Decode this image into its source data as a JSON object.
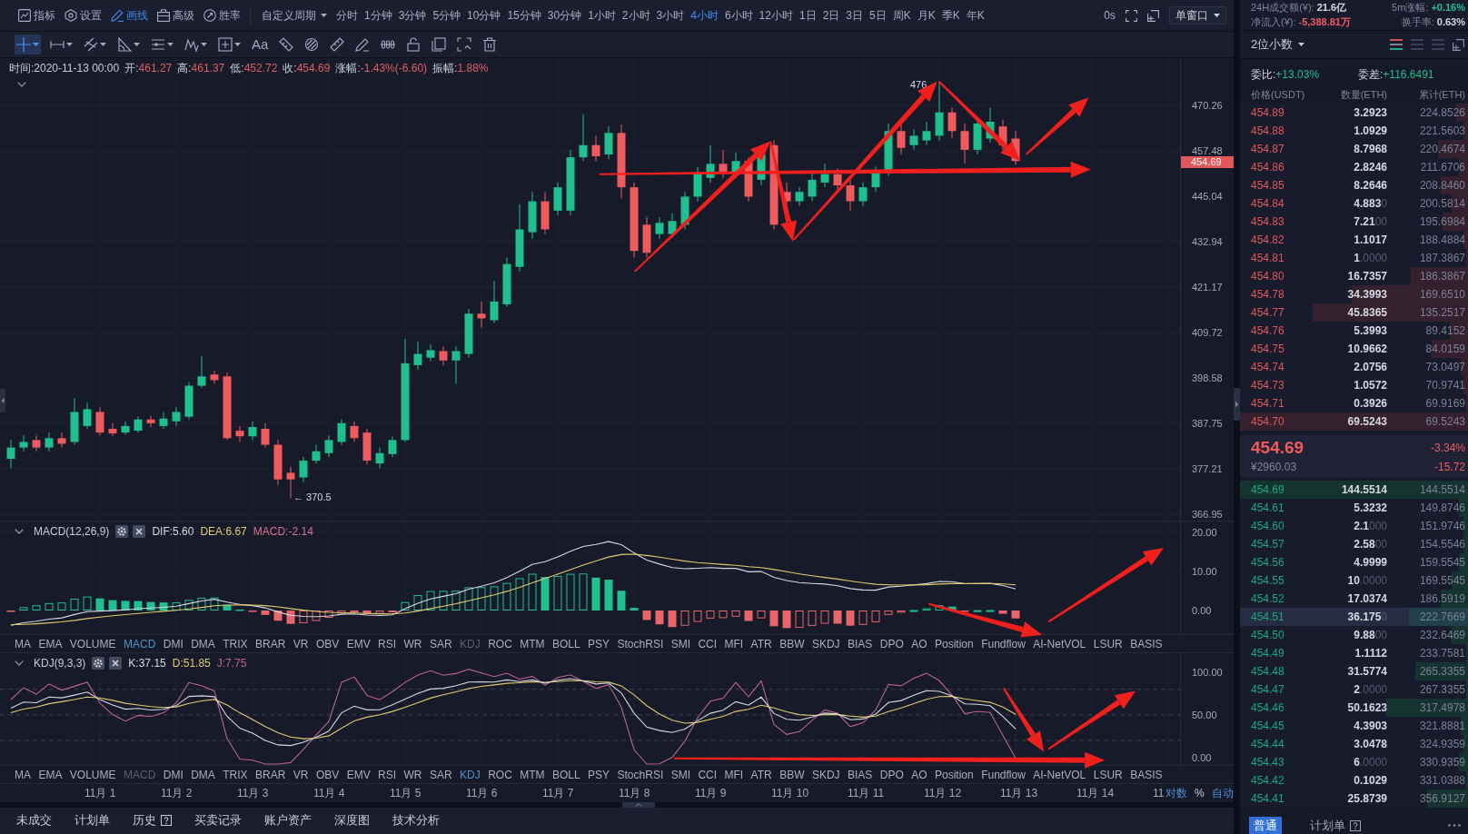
{
  "top_toolbar": {
    "tools": [
      {
        "label": "指标",
        "selected": false
      },
      {
        "label": "设置",
        "selected": false
      },
      {
        "label": "画线",
        "selected": true
      },
      {
        "label": "高级",
        "selected": false
      },
      {
        "label": "胜率",
        "selected": false
      }
    ],
    "period_menu": "自定义周期",
    "periods": [
      {
        "label": "分时",
        "selected": false
      },
      {
        "label": "1分钟",
        "selected": false
      },
      {
        "label": "3分钟",
        "selected": false
      },
      {
        "label": "5分钟",
        "selected": false
      },
      {
        "label": "10分钟",
        "selected": false
      },
      {
        "label": "15分钟",
        "selected": false
      },
      {
        "label": "30分钟",
        "selected": false
      },
      {
        "label": "1小时",
        "selected": false
      },
      {
        "label": "2小时",
        "selected": false
      },
      {
        "label": "3小时",
        "selected": false
      },
      {
        "label": "4小时",
        "selected": true
      },
      {
        "label": "6小时",
        "selected": false
      },
      {
        "label": "12小时",
        "selected": false
      },
      {
        "label": "1日",
        "selected": false
      },
      {
        "label": "2日",
        "selected": false
      },
      {
        "label": "3日",
        "selected": false
      },
      {
        "label": "5日",
        "selected": false
      },
      {
        "label": "周K",
        "selected": false
      },
      {
        "label": "月K",
        "selected": false
      },
      {
        "label": "季K",
        "selected": false
      },
      {
        "label": "年K",
        "selected": false
      }
    ],
    "timer": "0s",
    "layout_menu": "单窗口"
  },
  "drawing_toolbar": {
    "tools": [
      {
        "kind": "icon",
        "selected": true,
        "menu": true
      },
      {
        "kind": "icon",
        "selected": false,
        "menu": true
      },
      {
        "kind": "icon",
        "selected": false,
        "menu": true
      },
      {
        "kind": "icon",
        "selected": false,
        "menu": true
      },
      {
        "kind": "icon",
        "selected": false,
        "menu": true
      },
      {
        "kind": "icon",
        "selected": false,
        "menu": true
      },
      {
        "kind": "icon",
        "selected": false,
        "menu": true
      },
      {
        "kind": "text",
        "label": "Aa",
        "selected": false,
        "menu": false
      },
      {
        "kind": "icon",
        "selected": false,
        "menu": false
      },
      {
        "kind": "icon",
        "selected": false,
        "menu": false
      },
      {
        "kind": "icon",
        "selected": false,
        "menu": false
      },
      {
        "kind": "icon",
        "selected": false,
        "menu": false
      },
      {
        "kind": "icon",
        "selected": false,
        "menu": false
      },
      {
        "kind": "icon",
        "selected": false,
        "menu": false
      },
      {
        "kind": "icon",
        "selected": false,
        "menu": false
      },
      {
        "kind": "icon",
        "selected": false,
        "menu": false
      },
      {
        "kind": "icon",
        "selected": false,
        "menu": false
      }
    ]
  },
  "quote_bar": {
    "time": "时间:2020-11-13 00:00",
    "fields": [
      {
        "label": "开:",
        "value": "461.27"
      },
      {
        "label": "高:",
        "value": "461.37"
      },
      {
        "label": "低:",
        "value": "452.72"
      },
      {
        "label": "收:",
        "value": "454.69"
      },
      {
        "label": "涨幅:",
        "value": "-1.43%(-6.60)"
      },
      {
        "label": "振幅:",
        "value": "1.88%"
      }
    ]
  },
  "price_chart": {
    "axis_labels": [
      "470.26",
      "457.48",
      "445.04",
      "432.94",
      "421.17",
      "409.72",
      "398.58",
      "387.75",
      "377.21",
      "366.95"
    ],
    "last_price": "454.69",
    "high_marker": "476",
    "low_marker": "← 370.5"
  },
  "macd_pane": {
    "title": "MACD(12,26,9)",
    "readings": [
      {
        "text": "DIF:5.60",
        "color": "#d6d9e2"
      },
      {
        "text": "DEA:6.67",
        "color": "#e3c96e"
      },
      {
        "text": "MACD:-2.14",
        "color": "#d9708a"
      }
    ],
    "axis_labels": [
      "20.00",
      "10.00",
      "0.00"
    ]
  },
  "macd_tabs": [
    {
      "label": "MA",
      "selected": false,
      "disabled": false
    },
    {
      "label": "EMA",
      "selected": false,
      "disabled": false
    },
    {
      "label": "VOLUME",
      "selected": false,
      "disabled": false
    },
    {
      "label": "MACD",
      "selected": true,
      "disabled": false
    },
    {
      "label": "DMI",
      "selected": false,
      "disabled": false
    },
    {
      "label": "DMA",
      "selected": false,
      "disabled": false
    },
    {
      "label": "TRIX",
      "selected": false,
      "disabled": false
    },
    {
      "label": "BRAR",
      "selected": false,
      "disabled": false
    },
    {
      "label": "VR",
      "selected": false,
      "disabled": false
    },
    {
      "label": "OBV",
      "selected": false,
      "disabled": false
    },
    {
      "label": "EMV",
      "selected": false,
      "disabled": false
    },
    {
      "label": "RSI",
      "selected": false,
      "disabled": false
    },
    {
      "label": "WR",
      "selected": false,
      "disabled": false
    },
    {
      "label": "SAR",
      "selected": false,
      "disabled": false
    },
    {
      "label": "KDJ",
      "selected": false,
      "disabled": true
    },
    {
      "label": "ROC",
      "selected": false,
      "disabled": false
    },
    {
      "label": "MTM",
      "selected": false,
      "disabled": false
    },
    {
      "label": "BOLL",
      "selected": false,
      "disabled": false
    },
    {
      "label": "PSY",
      "selected": false,
      "disabled": false
    },
    {
      "label": "StochRSI",
      "selected": false,
      "disabled": false
    },
    {
      "label": "SMI",
      "selected": false,
      "disabled": false
    },
    {
      "label": "CCI",
      "selected": false,
      "disabled": false
    },
    {
      "label": "MFI",
      "selected": false,
      "disabled": false
    },
    {
      "label": "ATR",
      "selected": false,
      "disabled": false
    },
    {
      "label": "BBW",
      "selected": false,
      "disabled": false
    },
    {
      "label": "SKDJ",
      "selected": false,
      "disabled": false
    },
    {
      "label": "BIAS",
      "selected": false,
      "disabled": false
    },
    {
      "label": "DPO",
      "selected": false,
      "disabled": false
    },
    {
      "label": "AO",
      "selected": false,
      "disabled": false
    },
    {
      "label": "Position",
      "selected": false,
      "disabled": false
    },
    {
      "label": "Fundflow",
      "selected": false,
      "disabled": false
    },
    {
      "label": "AI-NetVOL",
      "selected": false,
      "disabled": false
    },
    {
      "label": "LSUR",
      "selected": false,
      "disabled": false
    },
    {
      "label": "BASIS",
      "selected": false,
      "disabled": false
    }
  ],
  "kdj_pane": {
    "title": "KDJ(9,3,3)",
    "readings": [
      {
        "text": "K:37.15",
        "color": "#d6d9e2"
      },
      {
        "text": "D:51.85",
        "color": "#e3c96e"
      },
      {
        "text": "J:7.75",
        "color": "#c0628f"
      }
    ],
    "axis_labels": [
      "100.00",
      "50.00",
      "0.00"
    ]
  },
  "kdj_tabs": [
    {
      "label": "MA",
      "selected": false,
      "disabled": false
    },
    {
      "label": "EMA",
      "selected": false,
      "disabled": false
    },
    {
      "label": "VOLUME",
      "selected": false,
      "disabled": false
    },
    {
      "label": "MACD",
      "selected": false,
      "disabled": true
    },
    {
      "label": "DMI",
      "selected": false,
      "disabled": false
    },
    {
      "label": "DMA",
      "selected": false,
      "disabled": false
    },
    {
      "label": "TRIX",
      "selected": false,
      "disabled": false
    },
    {
      "label": "BRAR",
      "selected": false,
      "disabled": false
    },
    {
      "label": "VR",
      "selected": false,
      "disabled": false
    },
    {
      "label": "OBV",
      "selected": false,
      "disabled": false
    },
    {
      "label": "EMV",
      "selected": false,
      "disabled": false
    },
    {
      "label": "RSI",
      "selected": false,
      "disabled": false
    },
    {
      "label": "WR",
      "selected": false,
      "disabled": false
    },
    {
      "label": "SAR",
      "selected": false,
      "disabled": false
    },
    {
      "label": "KDJ",
      "selected": true,
      "disabled": false
    },
    {
      "label": "ROC",
      "selected": false,
      "disabled": false
    },
    {
      "label": "MTM",
      "selected": false,
      "disabled": false
    },
    {
      "label": "BOLL",
      "selected": false,
      "disabled": false
    },
    {
      "label": "PSY",
      "selected": false,
      "disabled": false
    },
    {
      "label": "StochRSI",
      "selected": false,
      "disabled": false
    },
    {
      "label": "SMI",
      "selected": false,
      "disabled": false
    },
    {
      "label": "CCI",
      "selected": false,
      "disabled": false
    },
    {
      "label": "MFI",
      "selected": false,
      "disabled": false
    },
    {
      "label": "ATR",
      "selected": false,
      "disabled": false
    },
    {
      "label": "BBW",
      "selected": false,
      "disabled": false
    },
    {
      "label": "SKDJ",
      "selected": false,
      "disabled": false
    },
    {
      "label": "BIAS",
      "selected": false,
      "disabled": false
    },
    {
      "label": "DPO",
      "selected": false,
      "disabled": false
    },
    {
      "label": "AO",
      "selected": false,
      "disabled": false
    },
    {
      "label": "Position",
      "selected": false,
      "disabled": false
    },
    {
      "label": "Fundflow",
      "selected": false,
      "disabled": false
    },
    {
      "label": "AI-NetVOL",
      "selected": false,
      "disabled": false
    },
    {
      "label": "LSUR",
      "selected": false,
      "disabled": false
    },
    {
      "label": "BASIS",
      "selected": false,
      "disabled": false
    }
  ],
  "date_axis": {
    "labels": [
      "11月 1",
      "11月 2",
      "11月 3",
      "11月 4",
      "11月 5",
      "11月 6",
      "11月 7",
      "11月 8",
      "11月 9",
      "11月 10",
      "11月 11",
      "11月 12",
      "11月 13",
      "11月 14",
      "11"
    ],
    "options": [
      {
        "label": "对数",
        "selected": true
      },
      {
        "label": "%",
        "selected": false
      },
      {
        "label": "自动",
        "selected": true
      }
    ]
  },
  "bottom_tabs": [
    {
      "label": "未成交",
      "help": false
    },
    {
      "label": "计划单",
      "help": false
    },
    {
      "label": "历史",
      "help": true
    },
    {
      "label": "买卖记录",
      "help": false
    },
    {
      "label": "账户资产",
      "help": false
    },
    {
      "label": "深度图",
      "help": false
    },
    {
      "label": "技术分析",
      "help": false
    }
  ],
  "market_stats": [
    {
      "label": "24H成交额(¥):",
      "value": "21.6亿",
      "color": "#d6d9e2"
    },
    {
      "label": "5m涨幅:",
      "value": "+0.16%",
      "color": "#1fbf8f"
    },
    {
      "label": "净流入(¥):",
      "value": "-5,388.81万",
      "color": "#ef5a5f"
    },
    {
      "label": "换手率:",
      "value": "0.63%",
      "color": "#d6d9e2"
    }
  ],
  "order_book": {
    "precision_menu": "2位小数",
    "view_modes": [
      {
        "selected": true
      },
      {
        "selected": false
      },
      {
        "selected": false
      }
    ],
    "ratio": {
      "label": "委比:",
      "value": "+13.03%"
    },
    "difference": {
      "label": "委差:",
      "value": "+116.6491"
    },
    "columns": [
      "价格(USDT)",
      "数量(ETH)",
      "累计(ETH)"
    ],
    "asks": [
      {
        "price": "454.89",
        "quantity": "3.2923",
        "total": "224.8526",
        "level": 0.05
      },
      {
        "price": "454.88",
        "quantity": "1.0929",
        "total": "221.5603",
        "level": 0.02
      },
      {
        "price": "454.87",
        "quantity": "8.7968",
        "total": "220.4674",
        "level": 0.13
      },
      {
        "price": "454.86",
        "quantity": "2.8246",
        "total": "211.6706",
        "level": 0.04
      },
      {
        "price": "454.85",
        "quantity": "8.2646",
        "total": "208.8460",
        "level": 0.12
      },
      {
        "price": "454.84",
        "quantity": "**4.883**0",
        "total": "200.5814",
        "level": 0.07
      },
      {
        "price": "454.83",
        "quantity": "**7.21**00",
        "total": "195.6984",
        "level": 0.11
      },
      {
        "price": "454.82",
        "quantity": "1.1017",
        "total": "188.4884",
        "level": 0.02
      },
      {
        "price": "454.81",
        "quantity": "**1**.0000",
        "total": "187.3867",
        "level": 0.01
      },
      {
        "price": "454.80",
        "quantity": "16.7357",
        "total": "186.3867",
        "level": 0.25
      },
      {
        "price": "454.78",
        "quantity": "34.3993",
        "total": "169.6510",
        "level": 0.51
      },
      {
        "price": "454.77",
        "quantity": "45.8365",
        "total": "135.2517",
        "level": 0.68
      },
      {
        "price": "454.76",
        "quantity": "5.3993",
        "total": "89.4152",
        "level": 0.08
      },
      {
        "price": "454.75",
        "quantity": "10.9662",
        "total": "84.0159",
        "level": 0.16
      },
      {
        "price": "454.74",
        "quantity": "2.0756",
        "total": "73.0497",
        "level": 0.03
      },
      {
        "price": "454.73",
        "quantity": "1.0572",
        "total": "70.9741",
        "level": 0.02
      },
      {
        "price": "454.71",
        "quantity": "0.3926",
        "total": "69.9169",
        "level": 0.01
      },
      {
        "price": "454.70",
        "quantity": "69.5243",
        "total": "69.5243",
        "level": 1
      }
    ],
    "last_trade": {
      "price": "454.69",
      "change_percent": "-3.34%",
      "fiat": "¥2960.03",
      "change": "-15.72"
    },
    "bids": [
      {
        "price": "454.69",
        "quantity": "144.5514",
        "total": "144.5514",
        "level": 1,
        "hovered": false
      },
      {
        "price": "454.61",
        "quantity": "5.3232",
        "total": "149.8746",
        "level": 0.04,
        "hovered": false
      },
      {
        "price": "454.60",
        "quantity": "**2.1**000",
        "total": "151.9746",
        "level": 0.02,
        "hovered": false
      },
      {
        "price": "454.57",
        "quantity": "**2.58**00",
        "total": "154.5546",
        "level": 0.02,
        "hovered": false
      },
      {
        "price": "454.56",
        "quantity": "4.9999",
        "total": "159.5545",
        "level": 0.04,
        "hovered": false
      },
      {
        "price": "454.55",
        "quantity": "**10**.0000",
        "total": "169.5545",
        "level": 0.07,
        "hovered": false
      },
      {
        "price": "454.52",
        "quantity": "17.0374",
        "total": "186.5919",
        "level": 0.12,
        "hovered": false
      },
      {
        "price": "454.51",
        "quantity": "**36.175**0",
        "total": "222.7669",
        "level": 0.26,
        "hovered": true
      },
      {
        "price": "454.50",
        "quantity": "**9.88**00",
        "total": "232.6469",
        "level": 0.07,
        "hovered": false
      },
      {
        "price": "454.49",
        "quantity": "1.1112",
        "total": "233.7581",
        "level": 0.01,
        "hovered": false
      },
      {
        "price": "454.48",
        "quantity": "31.5774",
        "total": "265.3355",
        "level": 0.23,
        "hovered": false
      },
      {
        "price": "454.47",
        "quantity": "**2**.0000",
        "total": "267.3355",
        "level": 0.01,
        "hovered": false
      },
      {
        "price": "454.46",
        "quantity": "50.1623",
        "total": "317.4978",
        "level": 0.36,
        "hovered": false
      },
      {
        "price": "454.45",
        "quantity": "4.3903",
        "total": "321.8881",
        "level": 0.03,
        "hovered": false
      },
      {
        "price": "454.44",
        "quantity": "3.0478",
        "total": "324.9359",
        "level": 0.02,
        "hovered": false
      },
      {
        "price": "454.43",
        "quantity": "**6**.0000",
        "total": "330.9359",
        "level": 0.04,
        "hovered": false
      },
      {
        "price": "454.42",
        "quantity": "0.1029",
        "total": "331.0388",
        "level": 0.01,
        "hovered": false
      },
      {
        "price": "454.41",
        "quantity": "25.8739",
        "total": "356.9127",
        "level": 0.18,
        "hovered": false
      }
    ],
    "order_types": [
      {
        "label": "普通",
        "selected": true,
        "help": false
      },
      {
        "label": "计划单",
        "selected": false,
        "help": true
      }
    ]
  }
}
